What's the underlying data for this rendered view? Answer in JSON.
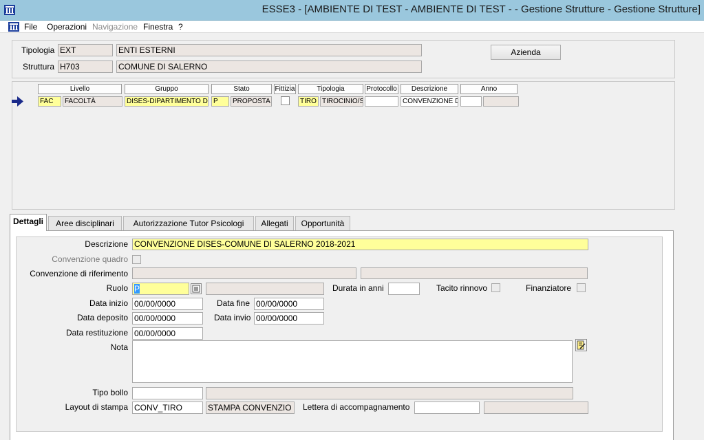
{
  "window": {
    "title": "ESSE3 - [AMBIENTE DI TEST - AMBIENTE DI TEST -  - Gestione Strutture - Gestione Strutture]"
  },
  "menu": {
    "file": "File",
    "operazioni": "Operazioni",
    "navigazione": "Navigazione",
    "finestra": "Finestra",
    "help": "?"
  },
  "header": {
    "tipologia_label": "Tipologia",
    "tipologia_code": "EXT",
    "tipologia_desc": "ENTI ESTERNI",
    "struttura_label": "Struttura",
    "struttura_code": "H703",
    "struttura_desc": "COMUNE DI SALERNO",
    "azienda_button": "Azienda"
  },
  "grid": {
    "headers": {
      "livello": "Livello",
      "gruppo": "Gruppo",
      "stato": "Stato",
      "fittizia": "Fittizia",
      "tipologia": "Tipologia",
      "protocollo": "Protocollo",
      "descrizione": "Descrizione",
      "anno": "Anno"
    },
    "row": {
      "livello_code": "FAC",
      "livello_desc": "FACOLTÀ",
      "gruppo": "DISES-DIPARTIMENTO DI",
      "stato_code": "P",
      "stato_desc": "PROPOSTA",
      "fittizia": false,
      "tipologia_code": "TIRO",
      "tipologia_desc": "TIROCINIO/S",
      "protocollo": "",
      "descrizione": "CONVENZIONE DI",
      "anno": ""
    }
  },
  "tabs": {
    "dettagli": "Dettagli",
    "aree": "Aree disciplinari",
    "autorizzazione": "Autorizzazione Tutor Psicologi",
    "allegati": "Allegati",
    "opportunita": "Opportunità"
  },
  "details": {
    "descrizione_label": "Descrizione",
    "descrizione": "CONVENZIONE DISES-COMUNE DI SALERNO 2018-2021",
    "conv_quadro_label": "Convenzione quadro",
    "conv_quadro": false,
    "conv_rif_label": "Convenzione di riferimento",
    "conv_rif_1": "",
    "conv_rif_2": "",
    "ruolo_label": "Ruolo",
    "ruolo_code": "P",
    "ruolo_desc": "",
    "durata_label": "Durata in anni",
    "durata": "",
    "tacito_label": "Tacito rinnovo",
    "tacito": false,
    "finanziatore_label": "Finanziatore",
    "finanziatore": false,
    "data_inizio_label": "Data inizio",
    "data_inizio": "00/00/0000",
    "data_fine_label": "Data fine",
    "data_fine": "00/00/0000",
    "data_deposito_label": "Data deposito",
    "data_deposito": "00/00/0000",
    "data_invio_label": "Data invio",
    "data_invio": "00/00/0000",
    "data_restituzione_label": "Data restituzione",
    "data_restituzione": "00/00/0000",
    "nota_label": "Nota",
    "nota": "",
    "tipo_bollo_label": "Tipo bollo",
    "tipo_bollo_code": "",
    "tipo_bollo_desc": "",
    "layout_label": "Layout di stampa",
    "layout_code": "CONV_TIRO",
    "layout_desc": "STAMPA CONVENZIO",
    "lettera_label": "Lettera di accompagnamento",
    "lettera_code": "",
    "lettera_desc": ""
  }
}
